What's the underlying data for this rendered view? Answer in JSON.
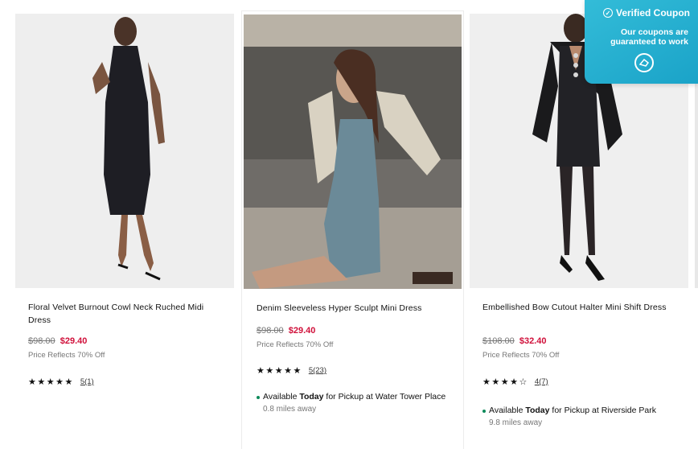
{
  "products": [
    {
      "title": "Floral Velvet Burnout Cowl Neck Ruched Midi Dress",
      "old_price": "$98.00",
      "new_price": "$29.40",
      "price_note": "Price Reflects 70% Off",
      "stars": "★★★★★",
      "review_count": "5(1)",
      "rating": 5
    },
    {
      "title": "Denim Sleeveless Hyper Sculpt Mini Dress",
      "old_price": "$98.00",
      "new_price": "$29.40",
      "price_note": "Price Reflects 70% Off",
      "stars": "★★★★★",
      "review_count": "5(23)",
      "rating": 5,
      "availability_prefix": "Available ",
      "availability_bold": "Today",
      "availability_suffix": " for Pickup at Water Tower Place",
      "distance": "0.8 miles away"
    },
    {
      "title": "Embellished Bow Cutout Halter Mini Shift Dress",
      "old_price": "$108.00",
      "new_price": "$32.40",
      "price_note": "Price Reflects 70% Off",
      "stars": "★★★★☆",
      "review_count": "4(7)",
      "rating": 4,
      "availability_prefix": "Available ",
      "availability_bold": "Today",
      "availability_suffix": " for Pickup at Riverside Park",
      "distance": "9.8 miles away"
    }
  ],
  "coupon": {
    "title": "Verified Coupon",
    "subtitle": "Our coupons are guaranteed to work",
    "logo_icon": "coupon-logo-icon"
  },
  "colors": {
    "sale_price": "#d0103a",
    "coupon_bg": "#1aa3c8",
    "availability_dot": "#0d8a5a"
  }
}
